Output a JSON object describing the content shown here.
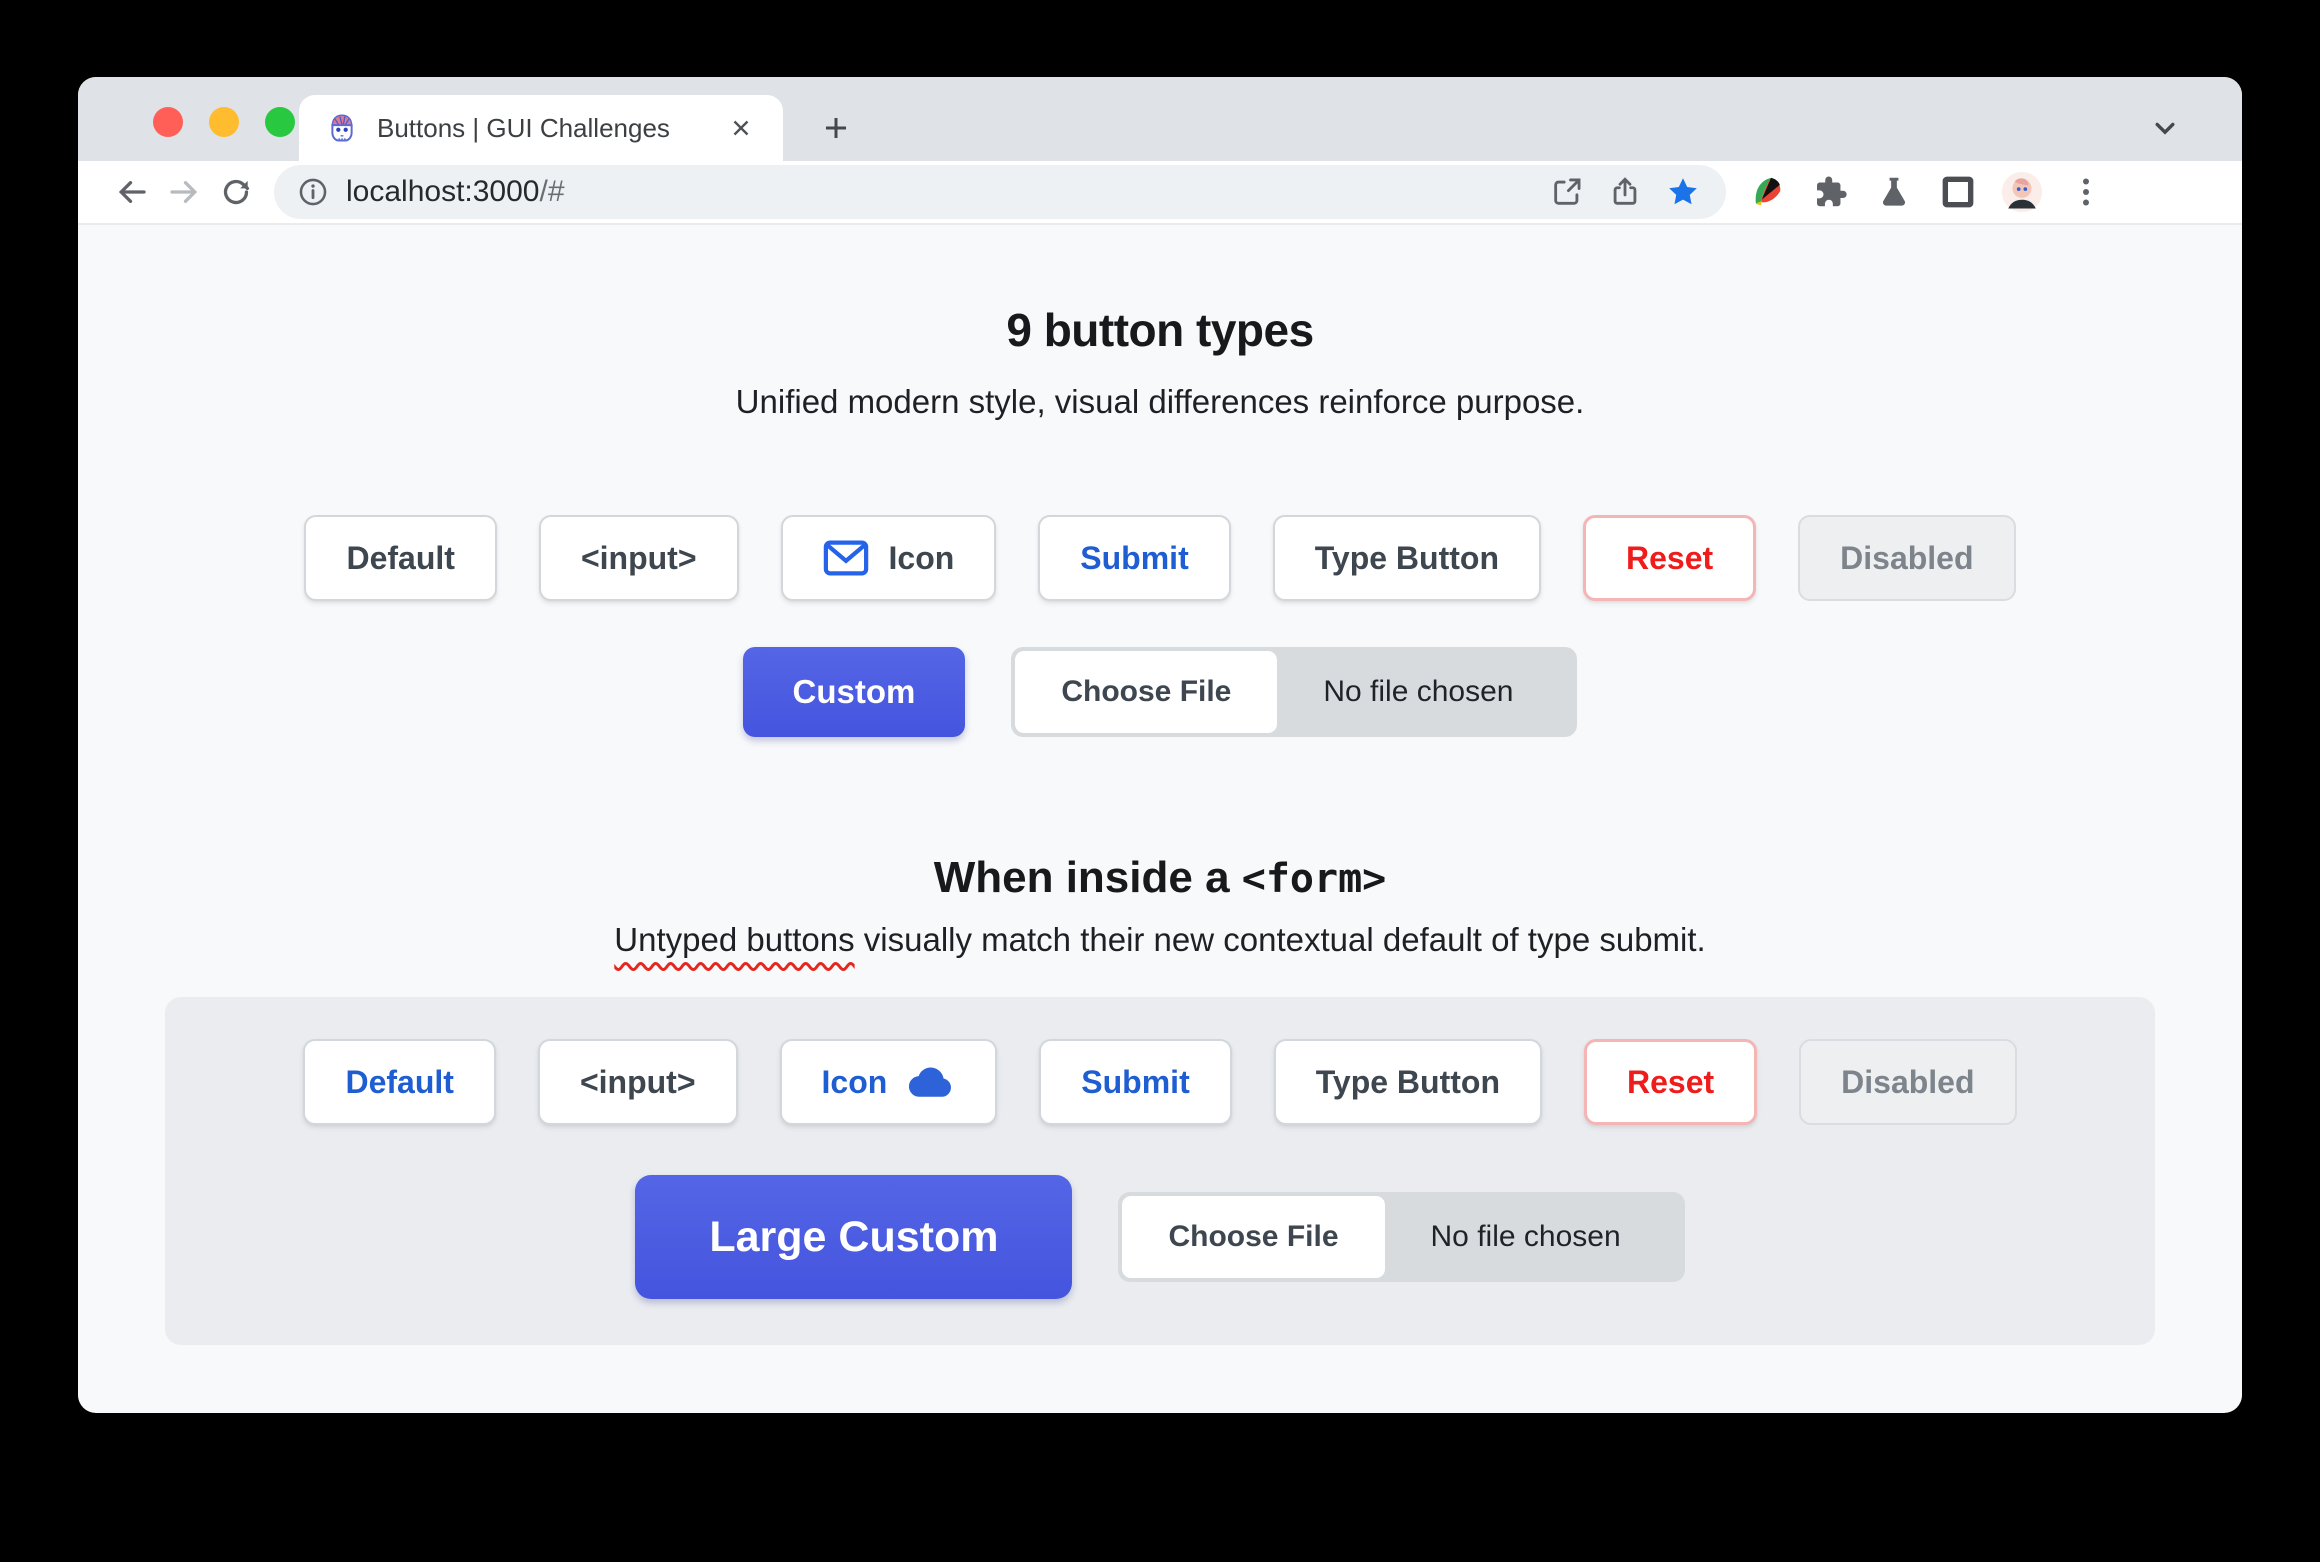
{
  "window": {
    "tab_title": "Buttons | GUI Challenges",
    "url_host": "localhost:3000",
    "url_path": "/#"
  },
  "hero": {
    "title": "9 button types",
    "subtitle": "Unified modern style, visual differences reinforce purpose.",
    "buttons": [
      {
        "label": "Default"
      },
      {
        "label": "<input>"
      },
      {
        "label": "Icon"
      },
      {
        "label": "Submit"
      },
      {
        "label": "Type Button"
      },
      {
        "label": "Reset"
      },
      {
        "label": "Disabled"
      }
    ],
    "custom_button": "Custom",
    "file_input": {
      "button_label": "Choose File",
      "status_text": "No file chosen"
    }
  },
  "form_section": {
    "title_text": "When inside a ",
    "title_code": "<form>",
    "subtitle_marked": "Untyped buttons",
    "subtitle_rest": " visually match their new contextual default of type submit.",
    "buttons": [
      {
        "label": "Default"
      },
      {
        "label": "<input>"
      },
      {
        "label": "Icon"
      },
      {
        "label": "Submit"
      },
      {
        "label": "Type Button"
      },
      {
        "label": "Reset"
      },
      {
        "label": "Disabled"
      }
    ],
    "large_custom_button": "Large Custom",
    "file_input": {
      "button_label": "Choose File",
      "status_text": "No file chosen"
    }
  },
  "colors": {
    "accent_blue": "#1f5ed2",
    "custom_indigo": "#4c5ce2",
    "reset_red": "#ef1c1c",
    "bookmark_blue": "#1a73e8"
  }
}
